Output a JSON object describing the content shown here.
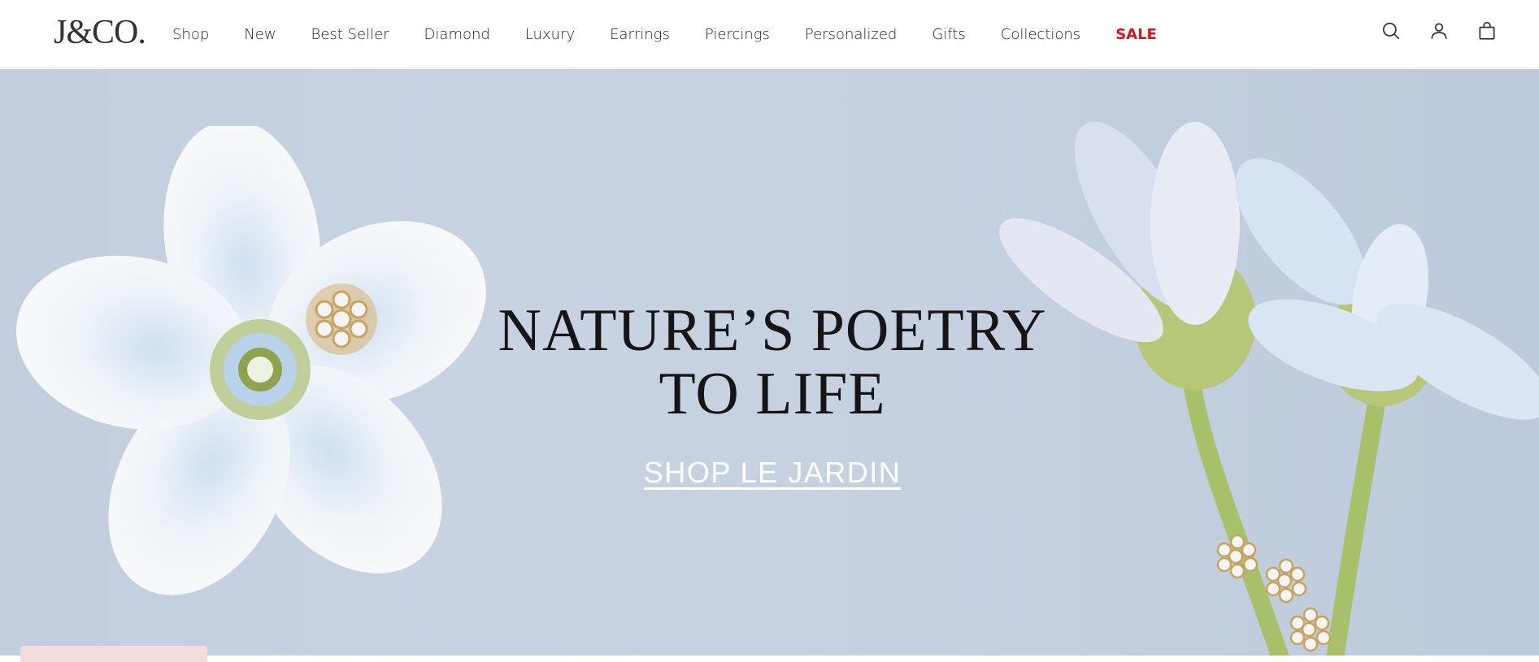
{
  "brand": {
    "logo_text": "J&CO."
  },
  "nav": {
    "items": [
      {
        "label": "Shop"
      },
      {
        "label": "New"
      },
      {
        "label": "Best Seller"
      },
      {
        "label": "Diamond"
      },
      {
        "label": "Luxury"
      },
      {
        "label": "Earrings"
      },
      {
        "label": "Piercings"
      },
      {
        "label": "Personalized"
      },
      {
        "label": "Gifts"
      },
      {
        "label": "Collections"
      },
      {
        "label": "SALE"
      }
    ]
  },
  "header_icons": [
    "search-icon",
    "account-icon",
    "bag-icon"
  ],
  "hero": {
    "headline_line1": "NATURE’S POETRY",
    "headline_line2": "TO LIFE",
    "cta_label": "SHOP LE JARDIN"
  },
  "colors": {
    "sale": "#e10f1e",
    "hero_bg": "#c6d1e0",
    "headline": "#151515",
    "cta": "#ffffff"
  }
}
